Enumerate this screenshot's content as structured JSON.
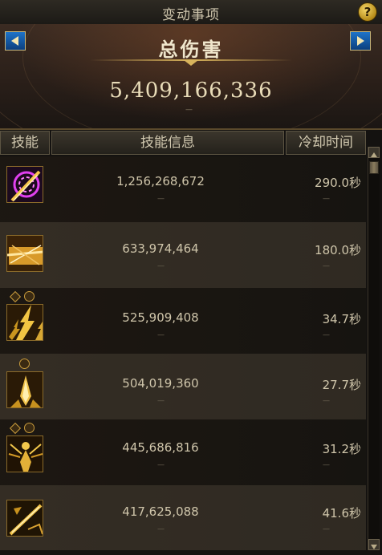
{
  "window": {
    "title": "变动事项",
    "help_label": "?"
  },
  "summary": {
    "label": "总伤害",
    "value": "5,409,166,336",
    "sub": "—"
  },
  "table": {
    "headers": {
      "skill": "技能",
      "info": "技能信息",
      "cooldown": "冷却时间"
    },
    "rows": [
      {
        "icon": "arcane-slash-skill-icon",
        "damage": "1,256,268,672",
        "cooldown": "290.0秒",
        "sub": "—"
      },
      {
        "icon": "golden-burst-skill-icon",
        "damage": "633,974,464",
        "cooldown": "180.0秒",
        "sub": "—"
      },
      {
        "icon": "lightning-strike-skill-icon",
        "damage": "525,909,408",
        "cooldown": "34.7秒",
        "sub": "—"
      },
      {
        "icon": "crystal-spike-skill-icon",
        "damage": "504,019,360",
        "cooldown": "27.7秒",
        "sub": "—"
      },
      {
        "icon": "radiant-figure-skill-icon",
        "damage": "445,686,816",
        "cooldown": "31.2秒",
        "sub": "—"
      },
      {
        "icon": "blade-slash-skill-icon",
        "damage": "417,625,088",
        "cooldown": "41.6秒",
        "sub": "—"
      }
    ]
  },
  "colors": {
    "accent_gold": "#d8b45c",
    "nav_blue": "#1e73c8",
    "text": "#cfc5aa"
  }
}
